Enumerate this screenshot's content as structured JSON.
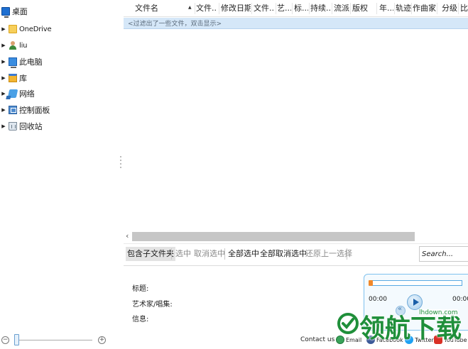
{
  "tree": {
    "items": [
      {
        "label": "桌面",
        "icon": "desktop-icon",
        "expandable": false
      },
      {
        "label": "OneDrive",
        "icon": "folder-icon",
        "expandable": true
      },
      {
        "label": "liu",
        "icon": "user-icon",
        "expandable": true
      },
      {
        "label": "此电脑",
        "icon": "computer-icon",
        "expandable": true
      },
      {
        "label": "库",
        "icon": "library-icon",
        "expandable": true
      },
      {
        "label": "网络",
        "icon": "network-icon",
        "expandable": true
      },
      {
        "label": "控制面板",
        "icon": "control-panel-icon",
        "expandable": true
      },
      {
        "label": "回收站",
        "icon": "recycle-bin-icon",
        "expandable": true
      }
    ]
  },
  "filelist": {
    "columns": [
      "文件名",
      "文件...",
      "修改日期",
      "文件...",
      "艺...",
      "标...",
      "持续...",
      "流派",
      "版权",
      "年...",
      "轨迹",
      "作曲家",
      "分级",
      "比"
    ],
    "sort_column": "文件名",
    "sort_direction": "ascending",
    "filter_text": "<过滤出了一些文件，双击显示>",
    "rows": []
  },
  "selection_toolbar": {
    "include_subfolders": "包含子文件夹",
    "select": "选中",
    "deselect": "取消选中",
    "select_all": "全部选中",
    "deselect_all": "全部取消选中",
    "restore_previous": "还原上一选择",
    "search_placeholder": "Search..."
  },
  "info": {
    "title_label": "标题:",
    "artist_album_label": "艺术家/唱集:",
    "info_label": "信息:"
  },
  "player": {
    "current_time": "00:00",
    "total_time": "00:00",
    "progress": 0
  },
  "status": {
    "zoom_minus": "−",
    "zoom_plus": "+",
    "zoom_level": 0,
    "contact": "Contact us",
    "social": [
      "Email",
      "Facebook",
      "Twitter",
      "YouTube"
    ]
  },
  "watermark": {
    "text": "领航下载",
    "url": "lhdown.com"
  },
  "colors": {
    "filter_bg": "#d5e7f8",
    "player_border": "#7fc1ee",
    "accent_orange": "#f0882a",
    "watermark_green": "#1f8f3a"
  }
}
